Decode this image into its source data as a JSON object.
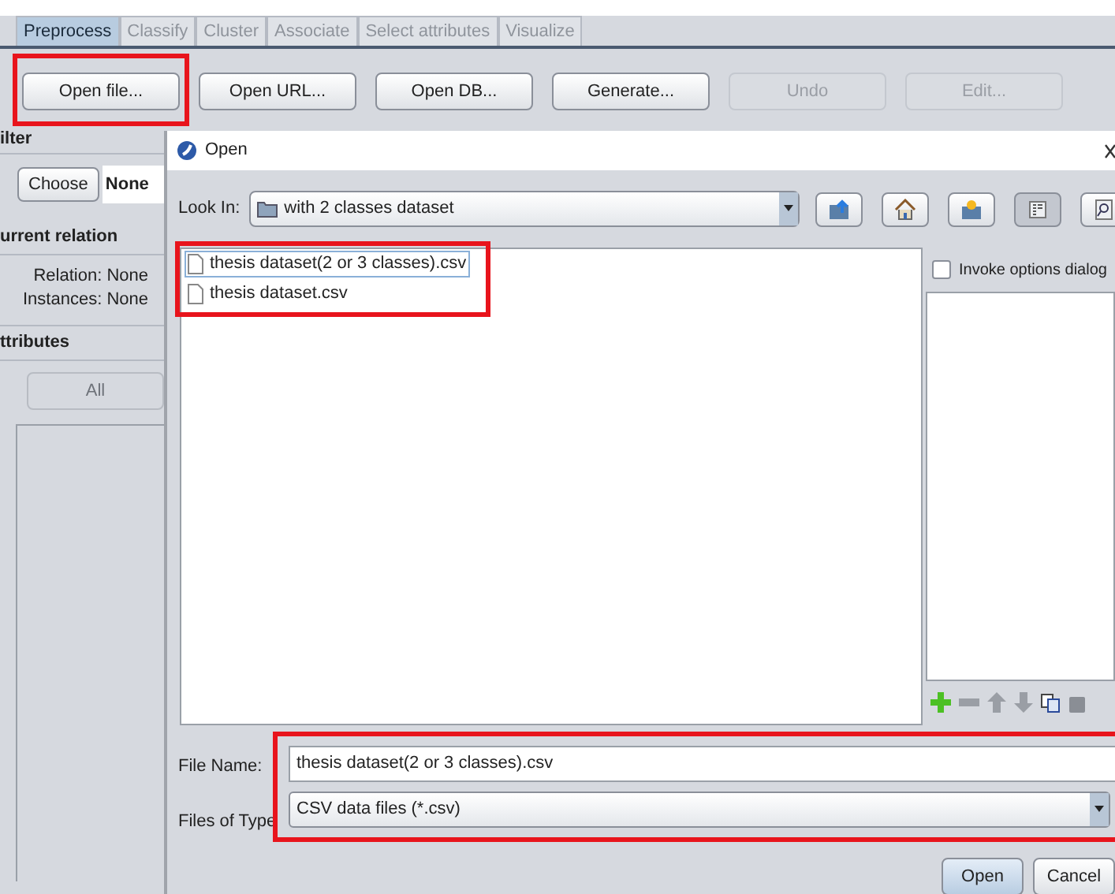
{
  "tabs": [
    {
      "label": "Preprocess",
      "selected": true,
      "disabled": false
    },
    {
      "label": "Classify",
      "selected": false,
      "disabled": true
    },
    {
      "label": "Cluster",
      "selected": false,
      "disabled": true
    },
    {
      "label": "Associate",
      "selected": false,
      "disabled": true
    },
    {
      "label": "Select attributes",
      "selected": false,
      "disabled": true
    },
    {
      "label": "Visualize",
      "selected": false,
      "disabled": true
    }
  ],
  "toolbar": [
    {
      "label": "Open file...",
      "disabled": false,
      "highlighted": true
    },
    {
      "label": "Open URL...",
      "disabled": false,
      "highlighted": false
    },
    {
      "label": "Open DB...",
      "disabled": false,
      "highlighted": false
    },
    {
      "label": "Generate...",
      "disabled": false,
      "highlighted": false
    },
    {
      "label": "Undo",
      "disabled": true,
      "highlighted": false
    },
    {
      "label": "Edit...",
      "disabled": true,
      "highlighted": false
    }
  ],
  "left_panel": {
    "filter": {
      "heading": "ilter",
      "choose_button": "Choose",
      "value": "None"
    },
    "current_relation": {
      "heading": "urrent relation",
      "relation_label": "Relation:",
      "relation_value": "None",
      "instances_label": "Instances:",
      "instances_value": "None"
    },
    "attributes": {
      "heading": "ttributes",
      "all_button": {
        "label": "All",
        "disabled": true
      }
    }
  },
  "dialog": {
    "title": "Open",
    "look_in_label": "Look In:",
    "look_in": "with 2 classes dataset",
    "views": [
      {
        "kind": "list",
        "selected": true
      },
      {
        "kind": "details",
        "selected": false
      }
    ],
    "files": [
      {
        "name": "thesis dataset(2 or 3 classes).csv",
        "selected": true
      },
      {
        "name": "thesis dataset.csv",
        "selected": false
      }
    ],
    "files_highlighted": true,
    "invoke_options": {
      "label": "Invoke options dialog",
      "checked": false
    },
    "file_name_label": "File Name:",
    "file_name": "thesis dataset(2 or 3 classes).csv",
    "files_of_type_label": "Files of Type",
    "files_of_type": "CSV data files (*.csv)",
    "fields_highlighted": true,
    "buttons": [
      {
        "label": "Open",
        "kind": "default"
      },
      {
        "label": "Cancel",
        "kind": "normal"
      }
    ]
  }
}
